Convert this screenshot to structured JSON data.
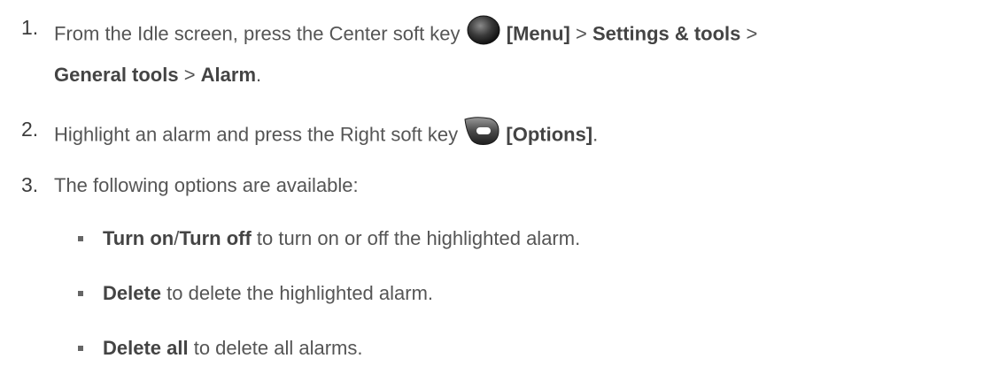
{
  "steps": [
    {
      "num": "1.",
      "line1": {
        "t1": "From the Idle screen, press the Center soft key ",
        "key_icon": "center-soft-key-icon",
        "b1": "[Menu]",
        "t2": " > ",
        "b2": "Settings & tools",
        "t3": " >"
      },
      "line2": {
        "b1": "General tools",
        "t1": " > ",
        "b2": "Alarm",
        "t2": "."
      }
    },
    {
      "num": "2.",
      "t1": "Highlight an alarm and press the Right soft key ",
      "key_icon": "right-soft-key-icon",
      "b1": "[Options]",
      "t2": "."
    },
    {
      "num": "3.",
      "t1": "The following options are available:"
    }
  ],
  "options": [
    {
      "b1": "Turn on",
      "sep": "/",
      "b2": "Turn off",
      "t": " to turn on or off the highlighted alarm."
    },
    {
      "b1": "Delete",
      "t": " to delete the highlighted alarm."
    },
    {
      "b1": "Delete all",
      "t": " to delete all alarms."
    }
  ]
}
